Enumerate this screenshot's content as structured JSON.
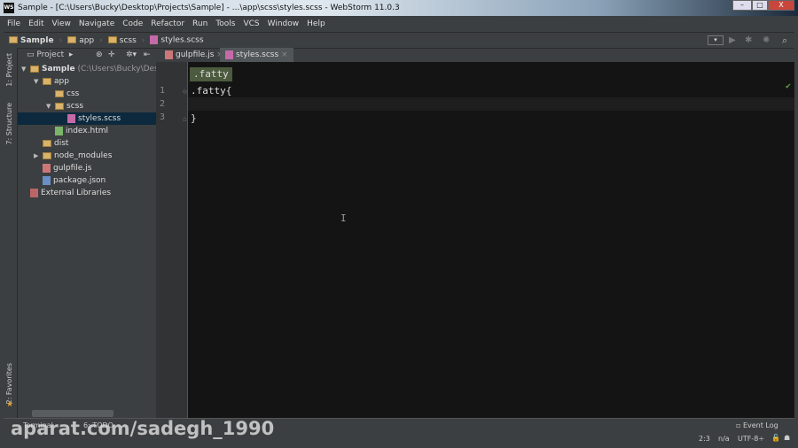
{
  "window": {
    "title": "Sample - [C:\\Users\\Bucky\\Desktop\\Projects\\Sample] - ...\\app\\scss\\styles.scss - WebStorm 11.0.3",
    "logo": "WS",
    "minimize": "–",
    "maximize": "□",
    "close": "X"
  },
  "menu": [
    "File",
    "Edit",
    "View",
    "Navigate",
    "Code",
    "Refactor",
    "Run",
    "Tools",
    "VCS",
    "Window",
    "Help"
  ],
  "breadcrumb": [
    "Sample",
    "app",
    "scss",
    "styles.scss"
  ],
  "project_panel": {
    "label": "Project",
    "tree": [
      {
        "label": "Sample",
        "extra": "(C:\\Users\\Bucky\\Desktop",
        "depth": 0,
        "arrow": "▼",
        "type": "folder"
      },
      {
        "label": "app",
        "depth": 1,
        "arrow": "▼",
        "type": "folder"
      },
      {
        "label": "css",
        "depth": 2,
        "arrow": "",
        "type": "folder"
      },
      {
        "label": "scss",
        "depth": 2,
        "arrow": "▼",
        "type": "folder"
      },
      {
        "label": "styles.scss",
        "depth": 3,
        "arrow": "",
        "type": "scss",
        "selected": true
      },
      {
        "label": "index.html",
        "depth": 2,
        "arrow": "",
        "type": "html"
      },
      {
        "label": "dist",
        "depth": 1,
        "arrow": "",
        "type": "folder"
      },
      {
        "label": "node_modules",
        "depth": 1,
        "arrow": "▶",
        "type": "folder"
      },
      {
        "label": "gulpfile.js",
        "depth": 1,
        "arrow": "",
        "type": "js"
      },
      {
        "label": "package.json",
        "depth": 1,
        "arrow": "",
        "type": "json"
      },
      {
        "label": "External Libraries",
        "depth": 0,
        "arrow": "",
        "type": "lib"
      }
    ]
  },
  "side_tabs": {
    "project": "1: Project",
    "structure": "7: Structure",
    "favorites": "2: Favorites"
  },
  "tabs": [
    {
      "label": "gulpfile.js",
      "active": false
    },
    {
      "label": "styles.scss",
      "active": true
    }
  ],
  "editor": {
    "breadcrumb": ".fatty",
    "lines": [
      ".fatty{",
      "",
      "}"
    ],
    "line_numbers": [
      "1",
      "2",
      "3"
    ]
  },
  "bottom": {
    "terminal": "Terminal",
    "todo": "6: TODO",
    "event_log": "Event Log",
    "position": "2:3",
    "na": "n/a",
    "encoding": "UTF-8÷"
  },
  "watermark": "aparat.com/sadegh_1990"
}
